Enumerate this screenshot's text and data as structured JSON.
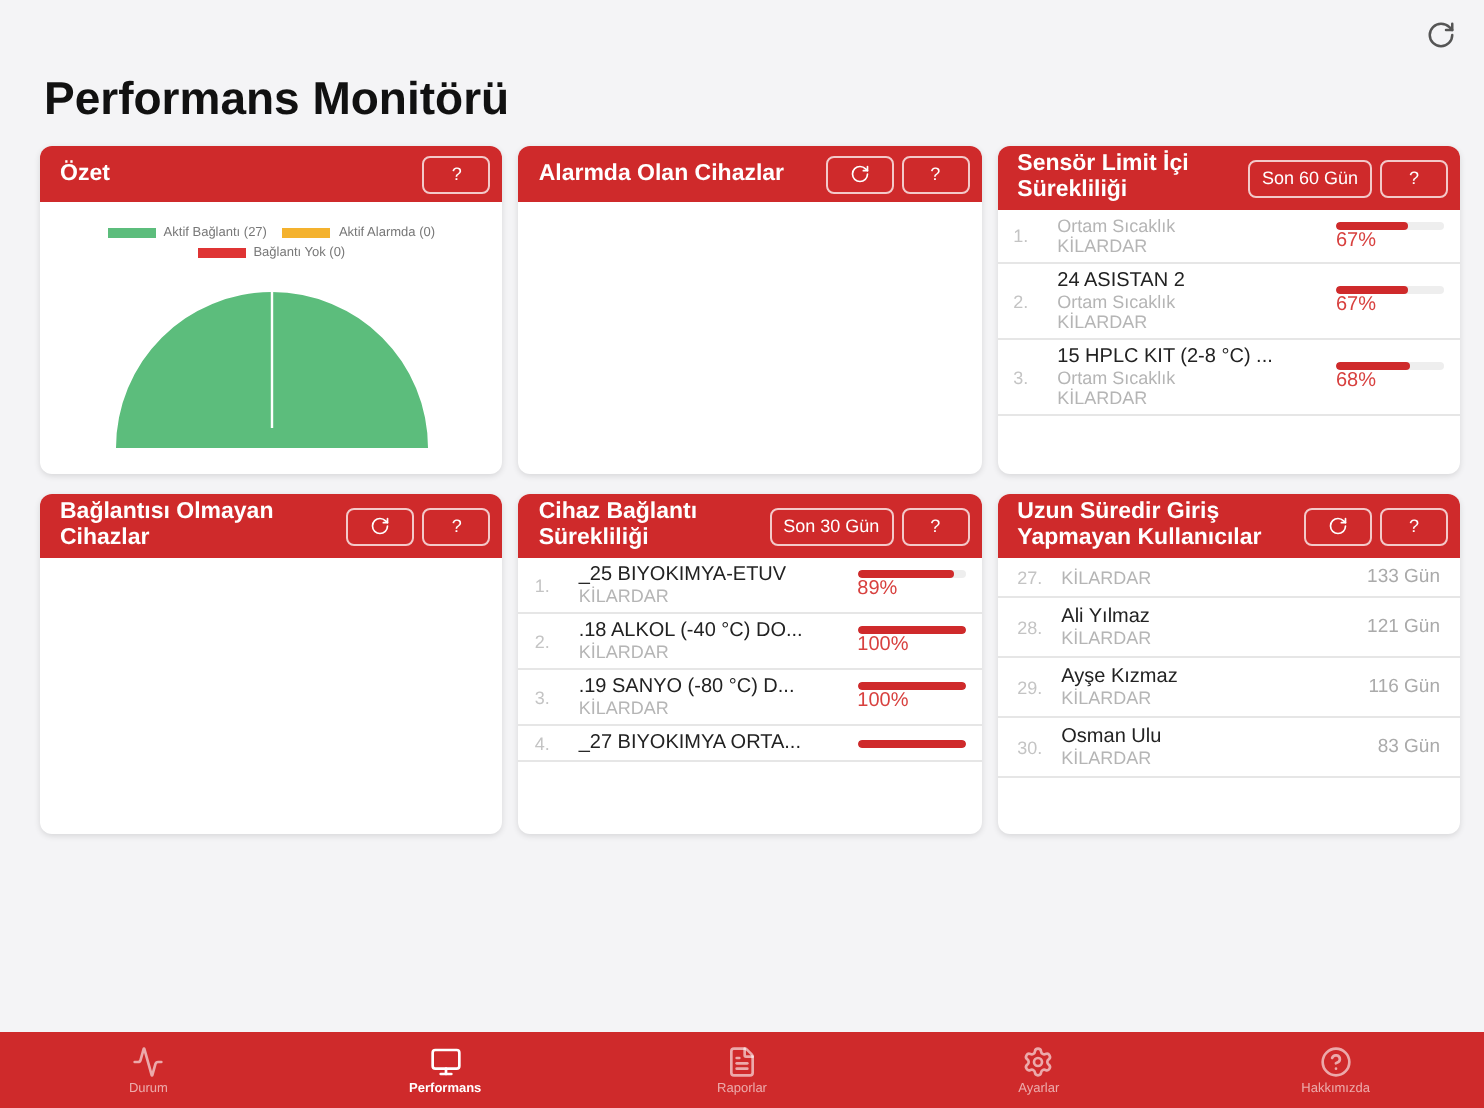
{
  "header": {
    "title": "Performans Monitörü"
  },
  "cards": [
    {
      "kind": "chart",
      "title": "Özet",
      "buttons": [
        {
          "kind": "help",
          "label": "?"
        }
      ],
      "legend": [
        {
          "label": "Aktif Bağlantı (27)",
          "color": "#5cbd7c"
        },
        {
          "label": "Aktif Alarmda (0)",
          "color": "#f4b22e"
        },
        {
          "label": "Bağlantı Yok (0)",
          "color": "#df3434"
        }
      ]
    },
    {
      "kind": "empty",
      "title": "Alarmda Olan Cihazlar",
      "buttons": [
        {
          "kind": "refresh"
        },
        {
          "kind": "help",
          "label": "?"
        }
      ]
    },
    {
      "kind": "sensor",
      "title": "Sensör Limit İçi Sürekliliği",
      "buttons": [
        {
          "kind": "period",
          "label": "Son 60 Gün"
        },
        {
          "kind": "help",
          "label": "?"
        }
      ],
      "rows": [
        {
          "number": "1.",
          "sensor": "Ortam Sıcaklık",
          "location": "KİLARDAR",
          "level": 0.67,
          "percent": "67%"
        },
        {
          "number": "2.",
          "name": "24 ASISTAN 2",
          "sensor": "Ortam Sıcaklık",
          "location": "KİLARDAR",
          "level": 0.67,
          "percent": "67%"
        },
        {
          "number": "3.",
          "name": "15 HPLC KIT (2-8 °C) ...",
          "sensor": "Ortam Sıcaklık",
          "location": "KİLARDAR",
          "level": 0.68,
          "percent": "68%"
        }
      ]
    },
    {
      "kind": "empty",
      "title": "Bağlantısı Olmayan Cihazlar",
      "buttons": [
        {
          "kind": "refresh"
        },
        {
          "kind": "help",
          "label": "?"
        }
      ]
    },
    {
      "kind": "connection",
      "title": "Cihaz Bağlantı Sürekliliği",
      "buttons": [
        {
          "kind": "period",
          "label": "Son 30 Gün"
        },
        {
          "kind": "help",
          "label": "?"
        }
      ],
      "rows": [
        {
          "number": "1.",
          "name": "_25 BIYOKIMYA-ETUV",
          "location": "KİLARDAR",
          "level": 0.89,
          "percent": "89%"
        },
        {
          "number": "2.",
          "name": ".18 ALKOL (-40 °C) DO...",
          "location": "KİLARDAR",
          "level": 1,
          "percent": "100%"
        },
        {
          "number": "3.",
          "name": ".19 SANYO (-80 °C) D...",
          "location": "KİLARDAR",
          "level": 1,
          "percent": "100%"
        },
        {
          "number": "4.",
          "name": "_27 BIYOKIMYA ORTA...",
          "level": 1
        }
      ]
    },
    {
      "kind": "users",
      "title": "Uzun Süredir Giriş Yapmayan Kullanıcılar",
      "buttons": [
        {
          "kind": "refresh"
        },
        {
          "kind": "help",
          "label": "?"
        }
      ],
      "rows": [
        {
          "number": "27.",
          "role": "KİLARDAR",
          "days": "133 Gün"
        },
        {
          "number": "28.",
          "name": "Ali Yılmaz",
          "role": "KİLARDAR",
          "days": "121 Gün"
        },
        {
          "number": "29.",
          "name": "Ayşe Kızmaz",
          "role": "KİLARDAR",
          "days": "116 Gün"
        },
        {
          "number": "30.",
          "name": "Osman Ulu",
          "role": "KİLARDAR",
          "days": "83 Gün"
        }
      ]
    }
  ],
  "tabs": [
    {
      "kind": "status",
      "label": "Durum",
      "selected": false
    },
    {
      "kind": "performance",
      "label": "Performans",
      "selected": true
    },
    {
      "kind": "reports",
      "label": "Raporlar",
      "selected": false
    },
    {
      "kind": "settings",
      "label": "Ayarlar",
      "selected": false
    },
    {
      "kind": "about",
      "label": "Hakkımızda",
      "selected": false
    }
  ]
}
